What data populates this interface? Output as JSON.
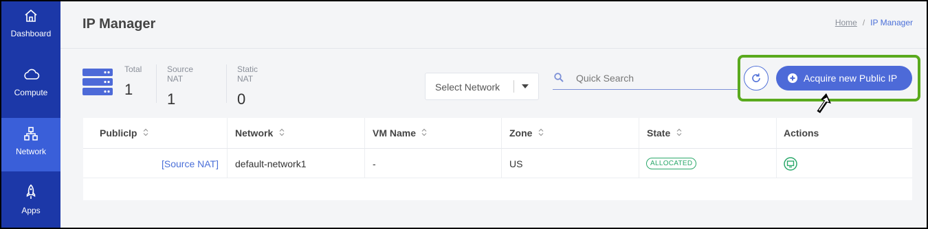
{
  "sidebar": {
    "items": [
      {
        "label": "Dashboard",
        "icon": "home-icon"
      },
      {
        "label": "Compute",
        "icon": "cloud-icon"
      },
      {
        "label": "Network",
        "icon": "network-icon",
        "active": true
      },
      {
        "label": "Apps",
        "icon": "rocket-icon"
      }
    ]
  },
  "header": {
    "title": "IP Manager",
    "breadcrumb": {
      "home": "Home",
      "separator": "/",
      "current": "IP Manager"
    }
  },
  "stats": {
    "icon": "servers-icon",
    "items": [
      {
        "label": "Total",
        "value": "1"
      },
      {
        "label": "Source NAT",
        "value": "1"
      },
      {
        "label": "Static NAT",
        "value": "0"
      }
    ]
  },
  "filters": {
    "network_select": "Select Network",
    "search_placeholder": "Quick Search"
  },
  "actions": {
    "refresh_icon": "refresh-icon",
    "acquire_label": "Acquire new Public IP",
    "highlight_color": "#5aaa1e"
  },
  "table": {
    "columns": [
      "PublicIp",
      "Network",
      "VM Name",
      "Zone",
      "State",
      "Actions"
    ],
    "rows": [
      {
        "public_ip": "[Source NAT]",
        "network": "default-network1",
        "vm_name": "-",
        "zone": "US",
        "state": "ALLOCATED",
        "action_icon": "console-icon"
      }
    ]
  },
  "colors": {
    "sidebar": "#1c38a8",
    "sidebar_active": "#3a5fd9",
    "primary": "#4d6ad8",
    "status_allocated": "#2aa86a"
  }
}
